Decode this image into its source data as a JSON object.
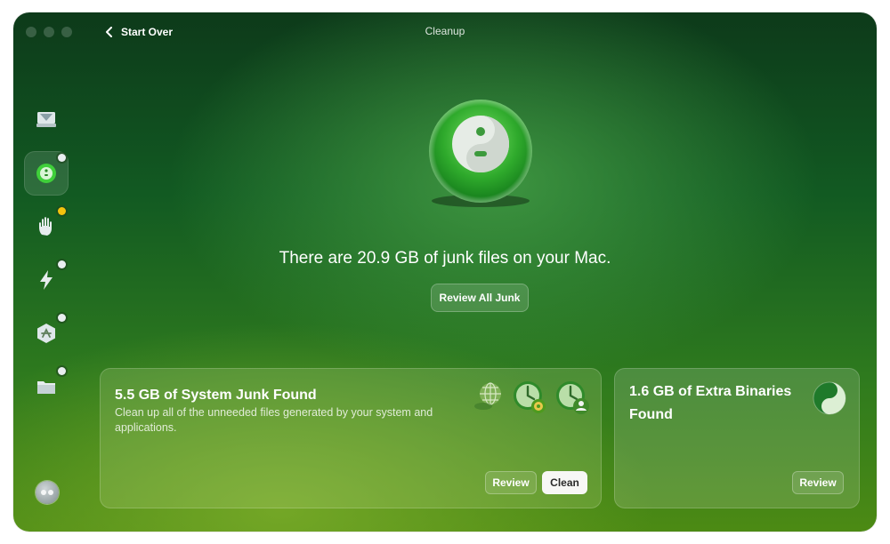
{
  "window": {
    "title": "Cleanup"
  },
  "nav": {
    "back_label": "Start Over"
  },
  "sidebar": {
    "items": [
      {
        "name": "dashboard",
        "icon": "monitor-icon",
        "status": "none"
      },
      {
        "name": "cleanup",
        "icon": "cleanup-icon",
        "status": "white",
        "active": true
      },
      {
        "name": "protection",
        "icon": "hand-icon",
        "status": "yellow"
      },
      {
        "name": "performance",
        "icon": "lightning-icon",
        "status": "white"
      },
      {
        "name": "applications",
        "icon": "apps-icon",
        "status": "white"
      },
      {
        "name": "my-clutter",
        "icon": "folder-icon",
        "status": "white"
      }
    ],
    "bottom_icon": "assistant-icon"
  },
  "hero": {
    "icon": "cleanup-disc-icon",
    "headline": "There are 20.9 GB of junk files on your Mac.",
    "review_all_label": "Review All Junk"
  },
  "cards": [
    {
      "title": "5.5 GB of System Junk Found",
      "description": "Clean up all of the unneeded files generated by your system and applications.",
      "icons": [
        "globe-icon",
        "clock-gear-icon",
        "clock-user-icon"
      ],
      "review_label": "Review",
      "clean_label": "Clean"
    },
    {
      "title": "1.6 GB of Extra Binaries Found",
      "icons": [
        "binaries-icon"
      ],
      "review_label": "Review"
    }
  ],
  "colors": {
    "accent_green": "#2e8a2e",
    "button_light": "#f7f7f5",
    "badge_yellow": "#f4c20d"
  }
}
